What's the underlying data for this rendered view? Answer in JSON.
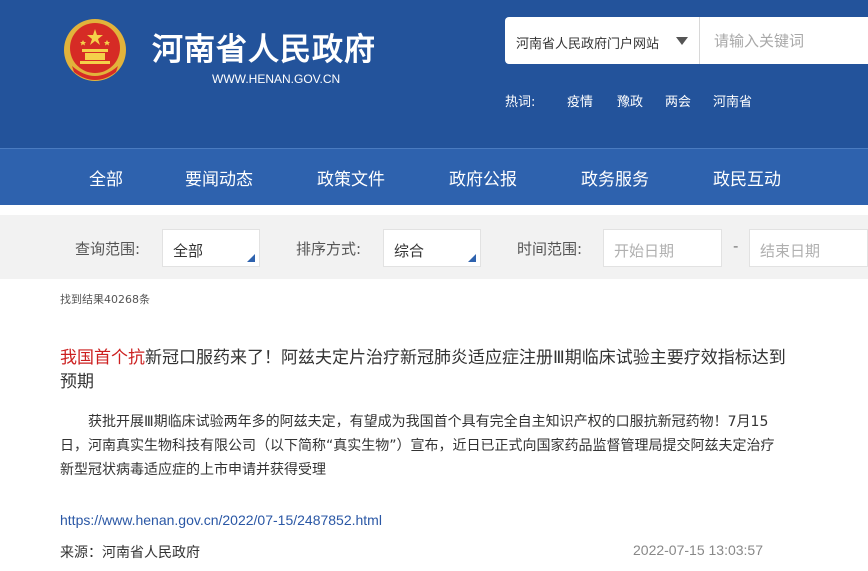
{
  "header": {
    "site_title": "河南省人民政府",
    "site_url": "WWW.HENAN.GOV.CN",
    "emblem": "national-emblem-icon"
  },
  "search": {
    "scope": "河南省人民政府门户网站",
    "placeholder": "请输入关键词"
  },
  "hot": {
    "label": "热词:",
    "items": [
      "疫情",
      "豫政",
      "两会",
      "河南省"
    ]
  },
  "nav": {
    "items": [
      "全部",
      "要闻动态",
      "政策文件",
      "政府公报",
      "政务服务",
      "政民互动"
    ]
  },
  "filters": {
    "range_label": "查询范围:",
    "range_value": "全部",
    "sort_label": "排序方式:",
    "sort_value": "综合",
    "time_label": "时间范围:",
    "start_placeholder": "开始日期",
    "dash": "-",
    "end_placeholder": "结束日期"
  },
  "results": {
    "count_text": "找到结果40268条",
    "items": [
      {
        "title_highlight": "我国首个抗",
        "title_rest": "新冠口服药来了！阿兹夫定片治疗新冠肺炎适应症注册Ⅲ期临床试验主要疗效指标达到预期",
        "summary": "获批开展Ⅲ期临床试验两年多的阿兹夫定，有望成为我国首个具有完全自主知识产权的口服抗新冠药物！7月15日，河南真实生物科技有限公司（以下简称“真实生物”）宣布，近日已正式向国家药品监督管理局提交阿兹夫定治疗新型冠状病毒适应症的上市申请并获得受理",
        "url": "https://www.henan.gov.cn/2022/07-15/2487852.html",
        "source": "来源：河南省人民政府",
        "date": "2022-07-15 13:03:57"
      }
    ]
  },
  "colors": {
    "header_bg": "#23539b",
    "nav_bg": "#2e62ae",
    "highlight": "#cc1f1f",
    "link": "#2a57a5"
  }
}
